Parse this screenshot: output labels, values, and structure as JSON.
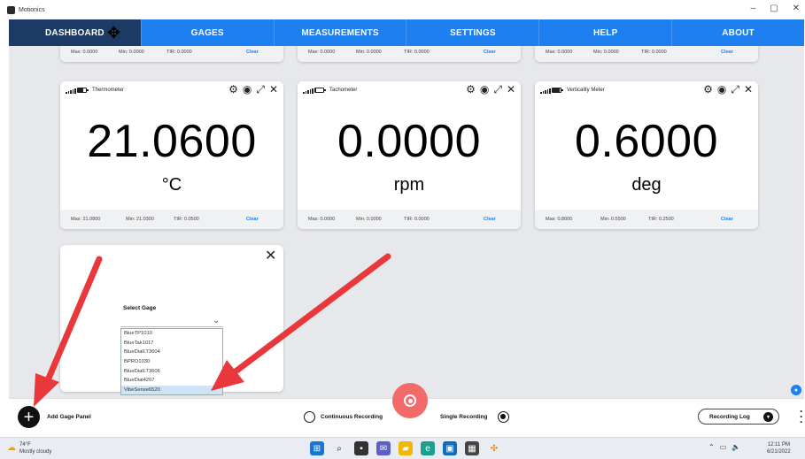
{
  "window": {
    "title": "Motionics",
    "minimize": "–",
    "maximize": "▢",
    "close": "✕"
  },
  "nav": [
    {
      "label": "DASHBOARD",
      "active": true
    },
    {
      "label": "GAGES"
    },
    {
      "label": "MEASUREMENTS"
    },
    {
      "label": "SETTINGS"
    },
    {
      "label": "HELP"
    },
    {
      "label": "ABOUT"
    }
  ],
  "top_cards": [
    {
      "max": "Max: 0.0000",
      "min": "Min: 0.0000",
      "tir": "TIR: 0.0000",
      "clear": "Clear"
    },
    {
      "max": "Max: 0.0000",
      "min": "Min: 0.0000",
      "tir": "TIR: 0.0000",
      "clear": "Clear"
    },
    {
      "max": "Max: 0.0000",
      "min": "Min: 0.0000",
      "tir": "TIR: 0.0000",
      "clear": "Clear"
    }
  ],
  "gage_cards": [
    {
      "name": "Thermometer",
      "value": "21.0600",
      "unit": "°C",
      "max": "Max: 21.0800",
      "min": "Min: 21.0300",
      "tir": "TIR: 0.0500",
      "clear": "Clear",
      "battery": 0.7
    },
    {
      "name": "Tachometer",
      "value": "0.0000",
      "unit": "rpm",
      "max": "Max: 0.0000",
      "min": "Min: 0.0000",
      "tir": "TIR: 0.0000",
      "clear": "Clear",
      "battery": 0.1
    },
    {
      "name": "Verticality Meter",
      "value": "0.6000",
      "unit": "deg",
      "max": "Max: 0.8000",
      "min": "Min: 0.5500",
      "tir": "TIR: 0.2500",
      "clear": "Clear",
      "battery": 0.9
    }
  ],
  "header_icons": [
    "gear-icon",
    "record-icon",
    "expand-icon",
    "close-icon"
  ],
  "select_gage": {
    "label": "Select Gage",
    "options": [
      "BlueTP1010",
      "BlueTak1017",
      "BlueDialLT3604",
      "BPRO1030",
      "BlueDialLT3606",
      "BlueDial4207",
      "VibeSense6520"
    ],
    "selected": "VibeSense6520"
  },
  "toolbar": {
    "add_label": "Add Gage Panel",
    "continuous_label": "Continuous Recording",
    "single_label": "Single Recording",
    "recording_log": "Recording Log"
  },
  "taskbar": {
    "temp": "74°F",
    "weather": "Mostly cloudy",
    "time": "12:11 PM",
    "date": "6/21/2022"
  },
  "colors": {
    "accent": "#1e7ff0",
    "active_tab": "#1b3a64",
    "record": "#f36a6a",
    "arrow": "#e8383b"
  }
}
